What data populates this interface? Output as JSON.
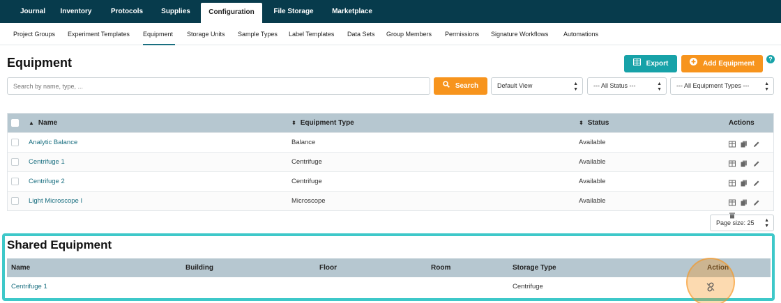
{
  "topnav": {
    "tabs": [
      {
        "label": "Journal",
        "active": false
      },
      {
        "label": "Inventory",
        "active": false
      },
      {
        "label": "Protocols",
        "active": false
      },
      {
        "label": "Supplies",
        "active": false
      },
      {
        "label": "Configuration",
        "active": true
      },
      {
        "label": "File Storage",
        "active": false
      },
      {
        "label": "Marketplace",
        "active": false
      }
    ]
  },
  "subnav": {
    "items": [
      {
        "label": "Project Groups"
      },
      {
        "label": "Experiment Templates"
      },
      {
        "label": "Equipment",
        "active": true
      },
      {
        "label": "Storage Units"
      },
      {
        "label": "Sample Types"
      },
      {
        "label": "Label Templates"
      },
      {
        "label": "Data Sets"
      },
      {
        "label": "Group Members"
      },
      {
        "label": "Permissions"
      },
      {
        "label": "Signature Workflows"
      },
      {
        "label": "Automations"
      }
    ]
  },
  "page": {
    "title": "Equipment",
    "export_label": "Export",
    "add_label": "Add Equipment",
    "help": "?"
  },
  "filters": {
    "search_placeholder": "Search by name, type, ...",
    "search_label": "Search",
    "view_value": "Default View",
    "status_value": "--- All Status ---",
    "type_value": "--- All Equipment Types ---"
  },
  "table": {
    "columns": {
      "name": "Name",
      "type": "Equipment Type",
      "status": "Status",
      "actions": "Actions"
    },
    "rows": [
      {
        "name": "Analytic Balance",
        "type": "Balance",
        "status": "Available"
      },
      {
        "name": "Centrifuge 1",
        "type": "Centrifuge",
        "status": "Available"
      },
      {
        "name": "Centrifuge 2",
        "type": "Centrifuge",
        "status": "Available"
      },
      {
        "name": "Light Microscope I",
        "type": "Microscope",
        "status": "Available"
      }
    ],
    "row_action_icons": [
      "table-icon",
      "copy-icon",
      "edit-icon",
      "trash-icon"
    ]
  },
  "pagination": {
    "page_size_label": "Page size: 25"
  },
  "shared": {
    "title": "Shared Equipment",
    "columns": {
      "name": "Name",
      "building": "Building",
      "floor": "Floor",
      "room": "Room",
      "storage_type": "Storage Type",
      "action": "Action"
    },
    "rows": [
      {
        "name": "Centrifuge 1",
        "building": "",
        "floor": "",
        "room": "",
        "storage_type": "Centrifuge"
      }
    ],
    "action_icon": "unlink-icon"
  },
  "colors": {
    "nav_bg": "#073b4c",
    "accent_teal": "#17a2a8",
    "accent_orange": "#f7941d",
    "table_header": "#b6c7d0",
    "highlight_border": "#3ec8c9",
    "link": "#1a6f80"
  }
}
